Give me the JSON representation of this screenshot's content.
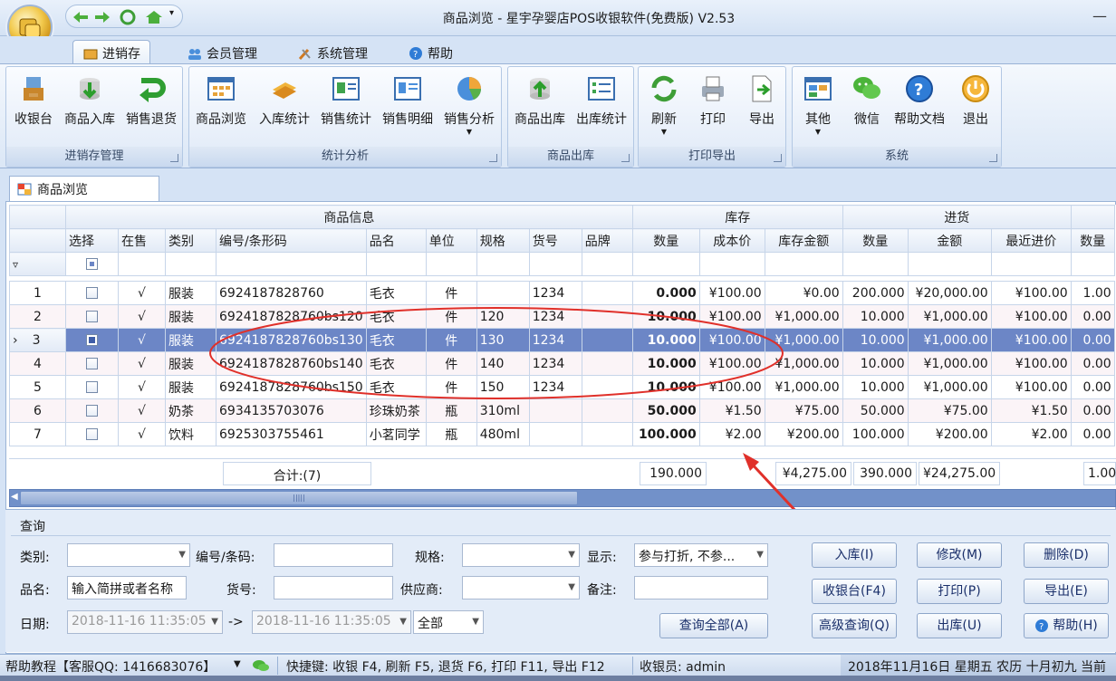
{
  "app": {
    "title": "商品浏览 - 星宇孕婴店POS收银软件(免费版) V2.53",
    "minimize_glyph": "—"
  },
  "colors": {
    "accent": "#6c86c6",
    "annotation_red": "#e0302a",
    "scroll": "#7291c9"
  },
  "tabs": [
    {
      "label": "进销存",
      "icon": "box-icon"
    },
    {
      "label": "会员管理",
      "icon": "people-icon"
    },
    {
      "label": "系统管理",
      "icon": "tools-icon"
    },
    {
      "label": "帮助",
      "icon": "help-icon"
    }
  ],
  "ribbon": {
    "groups": [
      {
        "label": "进销存管理",
        "buttons": [
          "收银台",
          "商品入库",
          "销售退货"
        ]
      },
      {
        "label": "统计分析",
        "buttons": [
          "商品浏览",
          "入库统计",
          "销售统计",
          "销售明细",
          "销售分析"
        ]
      },
      {
        "label": "商品出库",
        "buttons": [
          "商品出库",
          "出库统计"
        ]
      },
      {
        "label": "打印导出",
        "buttons": [
          "刷新",
          "打印",
          "导出"
        ]
      },
      {
        "label": "系统",
        "buttons": [
          "其他",
          "微信",
          "帮助文档",
          "退出"
        ]
      }
    ]
  },
  "doc_tab": "商品浏览",
  "grid": {
    "bands": {
      "info": "商品信息",
      "stock": "库存",
      "purchase": "进货"
    },
    "columns": [
      "选择",
      "在售",
      "类别",
      "编号/条形码",
      "品名",
      "单位",
      "规格",
      "货号",
      "品牌",
      "数量",
      "成本价",
      "库存金额",
      "数量",
      "金额",
      "最近进价",
      "数量"
    ],
    "filter_icon": "▿",
    "rows": [
      {
        "n": "1",
        "on": "√",
        "cat": "服装",
        "code": "6924187828760",
        "name": "毛衣",
        "unit": "件",
        "spec": "",
        "art": "1234",
        "brand": "",
        "qty": "0.000",
        "cost": "¥100.00",
        "amt": "¥0.00",
        "pqty": "200.000",
        "pamt": "¥20,000.00",
        "last": "¥100.00",
        "more": "1.00"
      },
      {
        "n": "2",
        "on": "√",
        "cat": "服装",
        "code": "6924187828760bs120",
        "name": "毛衣",
        "unit": "件",
        "spec": "120",
        "art": "1234",
        "brand": "",
        "qty": "10.000",
        "cost": "¥100.00",
        "amt": "¥1,000.00",
        "pqty": "10.000",
        "pamt": "¥1,000.00",
        "last": "¥100.00",
        "more": "0.00"
      },
      {
        "n": "3",
        "on": "√",
        "cat": "服装",
        "code": "6924187828760bs130",
        "name": "毛衣",
        "unit": "件",
        "spec": "130",
        "art": "1234",
        "brand": "",
        "qty": "10.000",
        "cost": "¥100.00",
        "amt": "¥1,000.00",
        "pqty": "10.000",
        "pamt": "¥1,000.00",
        "last": "¥100.00",
        "more": "0.00"
      },
      {
        "n": "4",
        "on": "√",
        "cat": "服装",
        "code": "6924187828760bs140",
        "name": "毛衣",
        "unit": "件",
        "spec": "140",
        "art": "1234",
        "brand": "",
        "qty": "10.000",
        "cost": "¥100.00",
        "amt": "¥1,000.00",
        "pqty": "10.000",
        "pamt": "¥1,000.00",
        "last": "¥100.00",
        "more": "0.00"
      },
      {
        "n": "5",
        "on": "√",
        "cat": "服装",
        "code": "6924187828760bs150",
        "name": "毛衣",
        "unit": "件",
        "spec": "150",
        "art": "1234",
        "brand": "",
        "qty": "10.000",
        "cost": "¥100.00",
        "amt": "¥1,000.00",
        "pqty": "10.000",
        "pamt": "¥1,000.00",
        "last": "¥100.00",
        "more": "0.00"
      },
      {
        "n": "6",
        "on": "√",
        "cat": "奶茶",
        "code": "6934135703076",
        "name": "珍珠奶茶",
        "unit": "瓶",
        "spec": "310ml",
        "art": "",
        "brand": "",
        "qty": "50.000",
        "cost": "¥1.50",
        "amt": "¥75.00",
        "pqty": "50.000",
        "pamt": "¥75.00",
        "last": "¥1.50",
        "more": "0.00"
      },
      {
        "n": "7",
        "on": "√",
        "cat": "饮料",
        "code": "6925303755461",
        "name": "小茗同学",
        "unit": "瓶",
        "spec": "480ml",
        "art": "",
        "brand": "",
        "qty": "100.000",
        "cost": "¥2.00",
        "amt": "¥200.00",
        "pqty": "100.000",
        "pamt": "¥200.00",
        "last": "¥2.00",
        "more": "0.00"
      }
    ],
    "selected_row": "3",
    "current_row_marker": "›",
    "footer": {
      "count": "合计:(7)",
      "qty": "190.000",
      "amt": "¥4,275.00",
      "pqty": "390.000",
      "pamt": "¥24,275.00",
      "more": "1.00"
    },
    "scroll_grip": "|||||"
  },
  "query": {
    "title": "查询",
    "labels": {
      "category": "类别:",
      "code": "编号/条码:",
      "spec": "规格:",
      "display": "显示:",
      "name": "品名:",
      "art": "货号:",
      "supplier": "供应商:",
      "note": "备注:",
      "date": "日期:",
      "arrow": "->"
    },
    "name_value": "输入简拼或者名称",
    "display_value": "参与打折, 不参...",
    "date_from": "2018-11-16 11:35:05",
    "date_to": "2018-11-16 11:35:05",
    "date_range": "全部",
    "buttons": {
      "stock_in": "入库(I)",
      "edit": "修改(M)",
      "delete": "删除(D)",
      "pos": "收银台(F4)",
      "print": "打印(P)",
      "export": "导出(E)",
      "query_all": "查询全部(A)",
      "adv": "高级查询(Q)",
      "stock_out": "出库(U)",
      "help": "帮助(H)"
    }
  },
  "status": {
    "help": "帮助教程【客服QQ: 1416683076】",
    "shortcuts": "快捷键: 收银 F4, 刷新 F5, 退货 F6, 打印 F11, 导出 F12",
    "cashier": "收银员: admin",
    "date": "2018年11月16日 星期五 农历 十月初九 当前"
  }
}
